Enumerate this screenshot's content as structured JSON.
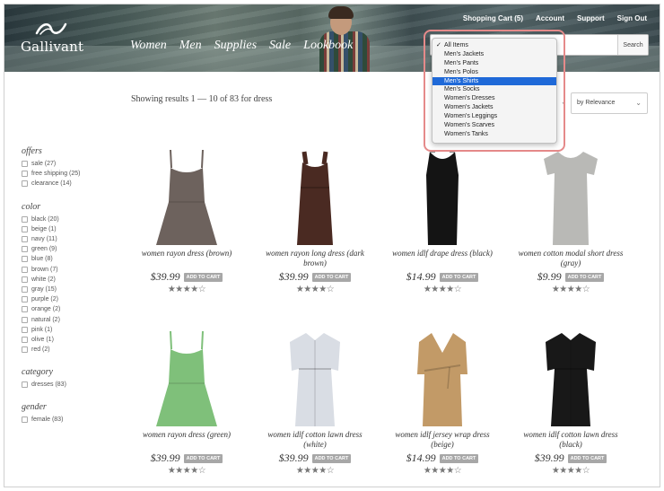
{
  "brand": {
    "name": "Gallivant"
  },
  "header": {
    "main_nav": [
      "Women",
      "Men",
      "Supplies",
      "Sale",
      "Lookbook"
    ],
    "top_nav": [
      "Shopping Cart (5)",
      "Account",
      "Support",
      "Sign Out"
    ],
    "search_button": "Search"
  },
  "results_text": "Showing results 1 — 10 of 83 for dress",
  "sort": {
    "selected": "by Relevance"
  },
  "dropdown": {
    "items": [
      "All Items",
      "Men's Jackets",
      "Men's Pants",
      "Men's Polos",
      "Men's Shirts",
      "Men's Socks",
      "Women's Dresses",
      "Women's Jackets",
      "Women's Leggings",
      "Women's Scarves",
      "Women's Tanks"
    ],
    "checked": "All Items",
    "highlighted": "Men's Shirts"
  },
  "facets": [
    {
      "title": "offers",
      "items": [
        "sale (27)",
        "free shipping (25)",
        "clearance (14)"
      ]
    },
    {
      "title": "color",
      "items": [
        "black (20)",
        "beige (1)",
        "navy (11)",
        "green (9)",
        "blue (8)",
        "brown (7)",
        "white (2)",
        "gray (15)",
        "purple (2)",
        "orange (2)",
        "natural (2)",
        "pink (1)",
        "olive (1)",
        "red (2)"
      ]
    },
    {
      "title": "category",
      "items": [
        "dresses (83)"
      ]
    },
    {
      "title": "gender",
      "items": [
        "female (83)"
      ]
    }
  ],
  "add_to_cart_label": "ADD TO CART",
  "products": [
    {
      "name": "women rayon dress (brown)",
      "price": "$39.99",
      "stars": "★★★★☆",
      "rating": 4,
      "color": "#6d625d"
    },
    {
      "name": "women rayon long dress (dark brown)",
      "price": "$39.99",
      "stars": "★★★★☆",
      "rating": 4,
      "color": "#4a2a22"
    },
    {
      "name": "women idlf drape dress (black)",
      "price": "$14.99",
      "stars": "★★★★☆",
      "rating": 4,
      "color": "#141414"
    },
    {
      "name": "women cotton modal short dress (gray)",
      "price": "$9.99",
      "stars": "★★★★☆",
      "rating": 4,
      "color": "#b9b9b6"
    },
    {
      "name": "women rayon dress (green)",
      "price": "$39.99",
      "stars": "★★★★☆",
      "rating": 4,
      "color": "#7fc07a"
    },
    {
      "name": "women idlf cotton lawn dress (white)",
      "price": "$39.99",
      "stars": "★★★★☆",
      "rating": 4,
      "color": "#d9dde4"
    },
    {
      "name": "women idlf jersey wrap dress (beige)",
      "price": "$14.99",
      "stars": "★★★★☆",
      "rating": 4,
      "color": "#c29a67"
    },
    {
      "name": "women idlf cotton lawn dress (black)",
      "price": "$39.99",
      "stars": "★★★★☆",
      "rating": 4,
      "color": "#181818"
    }
  ]
}
